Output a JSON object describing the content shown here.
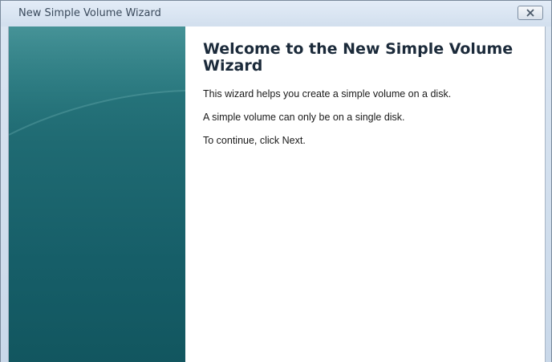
{
  "window": {
    "title": "New Simple Volume Wizard",
    "close_icon": "close-icon"
  },
  "wizard": {
    "heading": "Welcome to the New Simple Volume Wizard",
    "paragraphs": [
      "This wizard helps you create a simple volume on a disk.",
      "A simple volume can only be on a single disk.",
      "To continue, click Next."
    ]
  },
  "colors": {
    "side_panel_top": "#2e7f85",
    "side_panel_bottom": "#12565f",
    "titlebar": "#dbe6f2"
  }
}
